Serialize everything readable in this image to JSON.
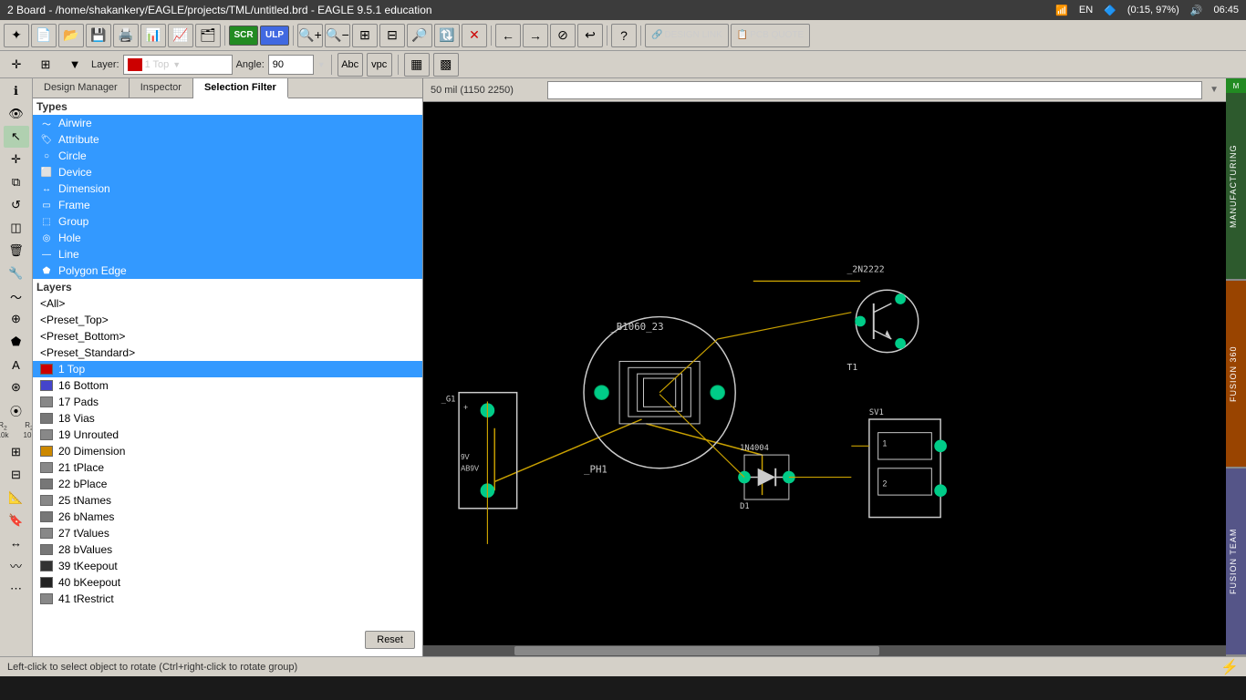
{
  "titlebar": {
    "title": "2 Board - /home/shakankery/EAGLE/projects/TML/untitled.brd - EAGLE 9.5.1 education",
    "wifi_icon": "wifi",
    "kb_icon": "EN",
    "bluetooth_icon": "bluetooth",
    "battery_info": "(0:15, 97%)",
    "volume_icon": "volume",
    "time": "06:45"
  },
  "toolbar1": {
    "buttons": [
      "✦",
      "💾",
      "💾",
      "📋",
      "📊",
      "📈",
      "📄",
      "SCR",
      "ULP",
      "🔍+",
      "🔍-",
      "🔍⊞",
      "🔍-",
      "🔍⊟",
      "🔃",
      "✕",
      "←",
      "→",
      "⊘",
      "↩",
      "?",
      "DESIGN LINK",
      "PCB QUOTE"
    ]
  },
  "toolbar2": {
    "layer_label": "Layer:",
    "layer_value": "1 Top",
    "layer_color": "#cc0000",
    "angle_label": "Angle:",
    "angle_value": "90",
    "btn_abc": "Abc",
    "btn_vpc": "vpc",
    "grid_icons": [
      "▦",
      "▩"
    ]
  },
  "tabs": {
    "design_manager": "Design Manager",
    "inspector": "Inspector",
    "selection_filter": "Selection Filter",
    "active": "selection_filter"
  },
  "types": {
    "label": "Types",
    "items": [
      {
        "name": "Airwire",
        "selected": true,
        "icon": "~"
      },
      {
        "name": "Attribute",
        "selected": true,
        "icon": "🏷"
      },
      {
        "name": "Circle",
        "selected": true,
        "icon": "○"
      },
      {
        "name": "Device",
        "selected": true,
        "icon": "⬜"
      },
      {
        "name": "Dimension",
        "selected": true,
        "icon": "↔"
      },
      {
        "name": "Frame",
        "selected": true,
        "icon": "⬜"
      },
      {
        "name": "Group",
        "selected": true,
        "icon": "⬚"
      },
      {
        "name": "Hole",
        "selected": true,
        "icon": "○"
      },
      {
        "name": "Line",
        "selected": true,
        "icon": "—"
      },
      {
        "name": "Polygon Edge",
        "selected": true,
        "icon": "⬟"
      }
    ]
  },
  "layers": {
    "label": "Layers",
    "presets": [
      {
        "name": "<All>"
      },
      {
        "name": "<Preset_Top>"
      },
      {
        "name": "<Preset_Bottom>"
      },
      {
        "name": "<Preset_Standard>"
      }
    ],
    "items": [
      {
        "num": 1,
        "name": "Top",
        "color": "#cc0000",
        "selected": true
      },
      {
        "num": 16,
        "name": "Bottom",
        "color": "#4444cc"
      },
      {
        "num": 17,
        "name": "Pads",
        "color": "#888888"
      },
      {
        "num": 18,
        "name": "Vias",
        "color": "#888888"
      },
      {
        "num": 19,
        "name": "Unrouted",
        "color": "#888888"
      },
      {
        "num": 20,
        "name": "Dimension",
        "color": "#cc8800"
      },
      {
        "num": 21,
        "name": "tPlace",
        "color": "#888888"
      },
      {
        "num": 22,
        "name": "bPlace",
        "color": "#888888"
      },
      {
        "num": 25,
        "name": "tNames",
        "color": "#888888"
      },
      {
        "num": 26,
        "name": "bNames",
        "color": "#888888"
      },
      {
        "num": 27,
        "name": "tValues",
        "color": "#888888"
      },
      {
        "num": 28,
        "name": "bValues",
        "color": "#888888"
      },
      {
        "num": 39,
        "name": "tKeepout",
        "color": "#444"
      },
      {
        "num": 40,
        "name": "bKeepout",
        "color": "#444"
      },
      {
        "num": 41,
        "name": "tRestrict",
        "color": "#888888"
      }
    ]
  },
  "reset_button": "Reset",
  "coord_bar": {
    "coord_text": "50 mil (1150 2250)",
    "search_placeholder": "|"
  },
  "statusbar": {
    "left_text": "Left-click to select object to rotate (Ctrl+right-click to rotate group)",
    "lightning_icon": "⚡"
  },
  "right_panel": {
    "buttons": [
      {
        "label": "MANUFACTURING",
        "style": "green"
      },
      {
        "label": "FUSION 360",
        "style": "orange"
      },
      {
        "label": "FUSION TEAM",
        "style": "purple"
      }
    ]
  }
}
